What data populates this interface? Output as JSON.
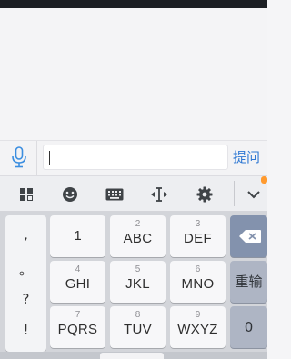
{
  "input_bar": {
    "ask_label": "提问",
    "text_value": ""
  },
  "toolbar": {
    "icons": [
      "grid-icon",
      "emoji-icon",
      "keyboard-icon",
      "cursor-icon",
      "gear-icon",
      "chevron-down-icon"
    ]
  },
  "keyboard": {
    "punctuation": [
      ",",
      "。",
      "?",
      "!"
    ],
    "keys": [
      {
        "num": "",
        "label": "1"
      },
      {
        "num": "2",
        "label": "ABC"
      },
      {
        "num": "3",
        "label": "DEF"
      },
      {
        "num": "4",
        "label": "GHI"
      },
      {
        "num": "5",
        "label": "JKL"
      },
      {
        "num": "6",
        "label": "MNO"
      },
      {
        "num": "7",
        "label": "PQRS"
      },
      {
        "num": "8",
        "label": "TUV"
      },
      {
        "num": "9",
        "label": "WXYZ"
      }
    ],
    "reinput_label": "重输",
    "zero_label": "0"
  },
  "colors": {
    "accent": "#2f78d3",
    "function_key": "#aeb5c4",
    "delete_key": "#8392ad",
    "keyboard_bg": "#d3d5da"
  }
}
